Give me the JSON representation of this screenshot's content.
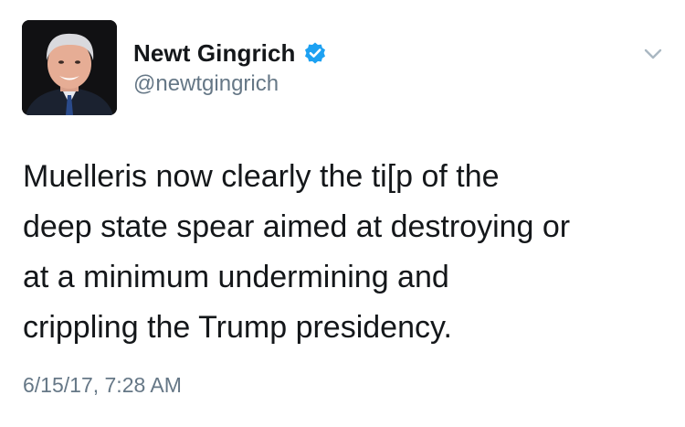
{
  "author": {
    "display_name": "Newt Gingrich",
    "handle": "@newtgingrich",
    "verified": true
  },
  "tweet": {
    "text": "Muelleris now clearly the ti[p of the\ndeep state spear aimed at destroying or\nat a minimum undermining and\ncrippling the Trump presidency.",
    "timestamp": "6/15/17, 7:28 AM"
  },
  "icons": {
    "verified": "verified-badge-icon",
    "menu": "chevron-down-icon"
  },
  "colors": {
    "verified_blue": "#1da1f2",
    "secondary_text": "#657786",
    "primary_text": "#14171a"
  }
}
